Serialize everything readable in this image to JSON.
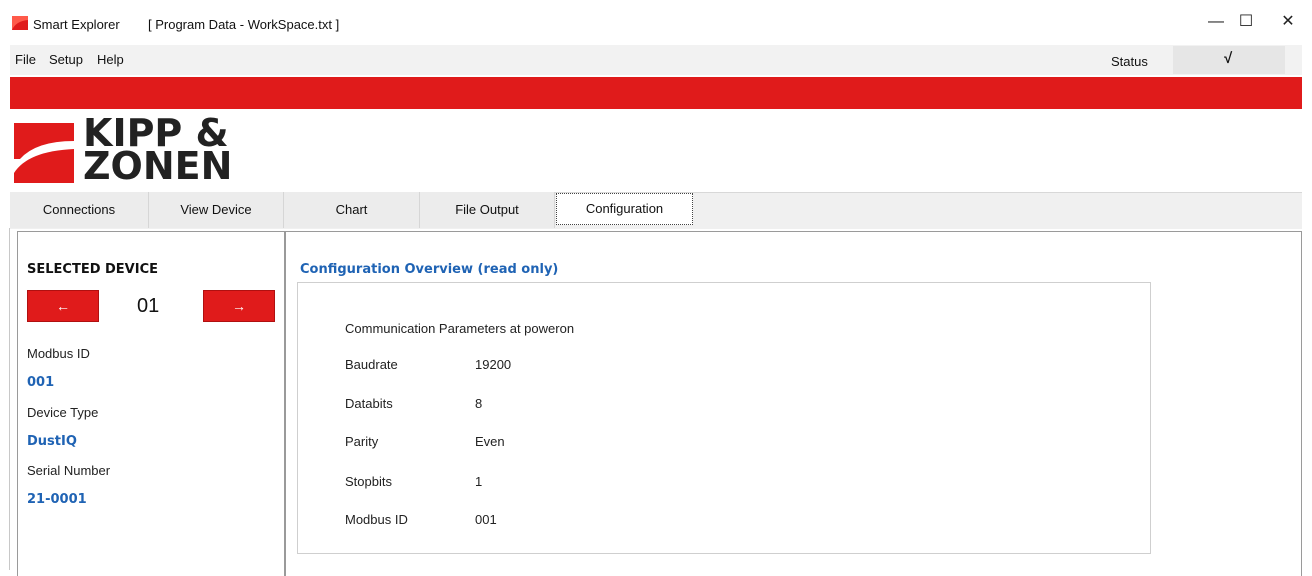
{
  "window": {
    "app_name": "Smart Explorer",
    "document": "[ Program Data - WorkSpace.txt ]",
    "minimize": "—",
    "maximize": "☐",
    "close": "✕"
  },
  "menu": {
    "items": [
      "File",
      "Setup",
      "Help"
    ],
    "status_label": "Status",
    "status_value": "√"
  },
  "brand": {
    "line1": "KIPP &",
    "line2": "ZONEN",
    "accent_color": "#e01b1b"
  },
  "tabs": [
    {
      "label": "Connections"
    },
    {
      "label": "View Device"
    },
    {
      "label": "Chart"
    },
    {
      "label": "File Output"
    },
    {
      "label": "Configuration"
    }
  ],
  "selected_device": {
    "title": "SELECTED DEVICE",
    "prev_icon": "←",
    "next_icon": "→",
    "number": "01",
    "modbus_id_label": "Modbus ID",
    "modbus_id_value": "001",
    "device_type_label": "Device Type",
    "device_type_value": "DustIQ",
    "serial_label": "Serial Number",
    "serial_value": "21-0001"
  },
  "config": {
    "title": "Configuration Overview (read only)",
    "header": "Communication Parameters at poweron",
    "params": [
      {
        "label": "Baudrate",
        "value": "19200"
      },
      {
        "label": "Databits",
        "value": "8"
      },
      {
        "label": "Parity",
        "value": "Even"
      },
      {
        "label": "Stopbits",
        "value": "1"
      },
      {
        "label": "Modbus ID",
        "value": "001"
      }
    ]
  }
}
